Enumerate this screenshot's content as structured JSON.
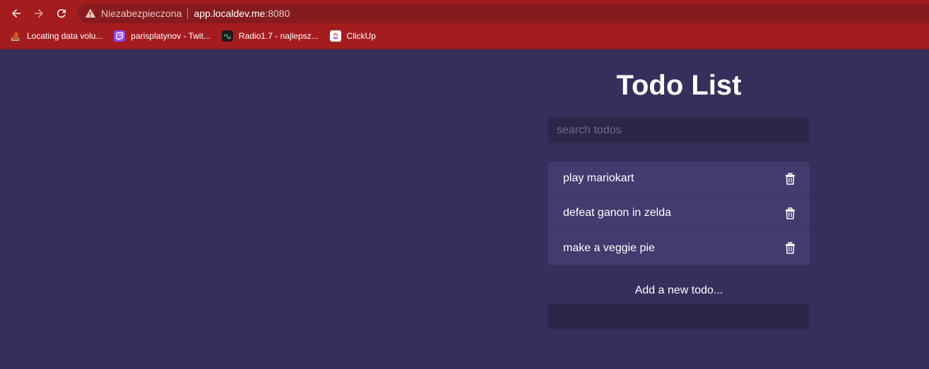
{
  "browser": {
    "security_label": "Niezabezpieczona",
    "url_host": "app.localdev.me",
    "url_port": ":8080",
    "bookmarks": [
      {
        "label": "Locating data volu...",
        "icon": "stackoverflow-icon",
        "color": "#f48024"
      },
      {
        "label": "parisplatynov - Twit...",
        "icon": "twitch-icon",
        "color": "#9146ff"
      },
      {
        "label": "Radio1.7 - najlepsz...",
        "icon": "radio-icon",
        "color": "#1c1c1c"
      },
      {
        "label": "ClickUp",
        "icon": "clickup-icon",
        "color": "#ffffff"
      }
    ]
  },
  "app": {
    "title": "Todo List",
    "search_placeholder": "search todos",
    "todos": [
      {
        "text": "play mariokart"
      },
      {
        "text": "defeat ganon in zelda"
      },
      {
        "text": "make a veggie pie"
      }
    ],
    "add_label": "Add a new todo...",
    "add_value": ""
  },
  "colors": {
    "background": "#352f5b",
    "item": "#433a6e",
    "input": "#2c2748",
    "chrome": "#a51c1f"
  }
}
